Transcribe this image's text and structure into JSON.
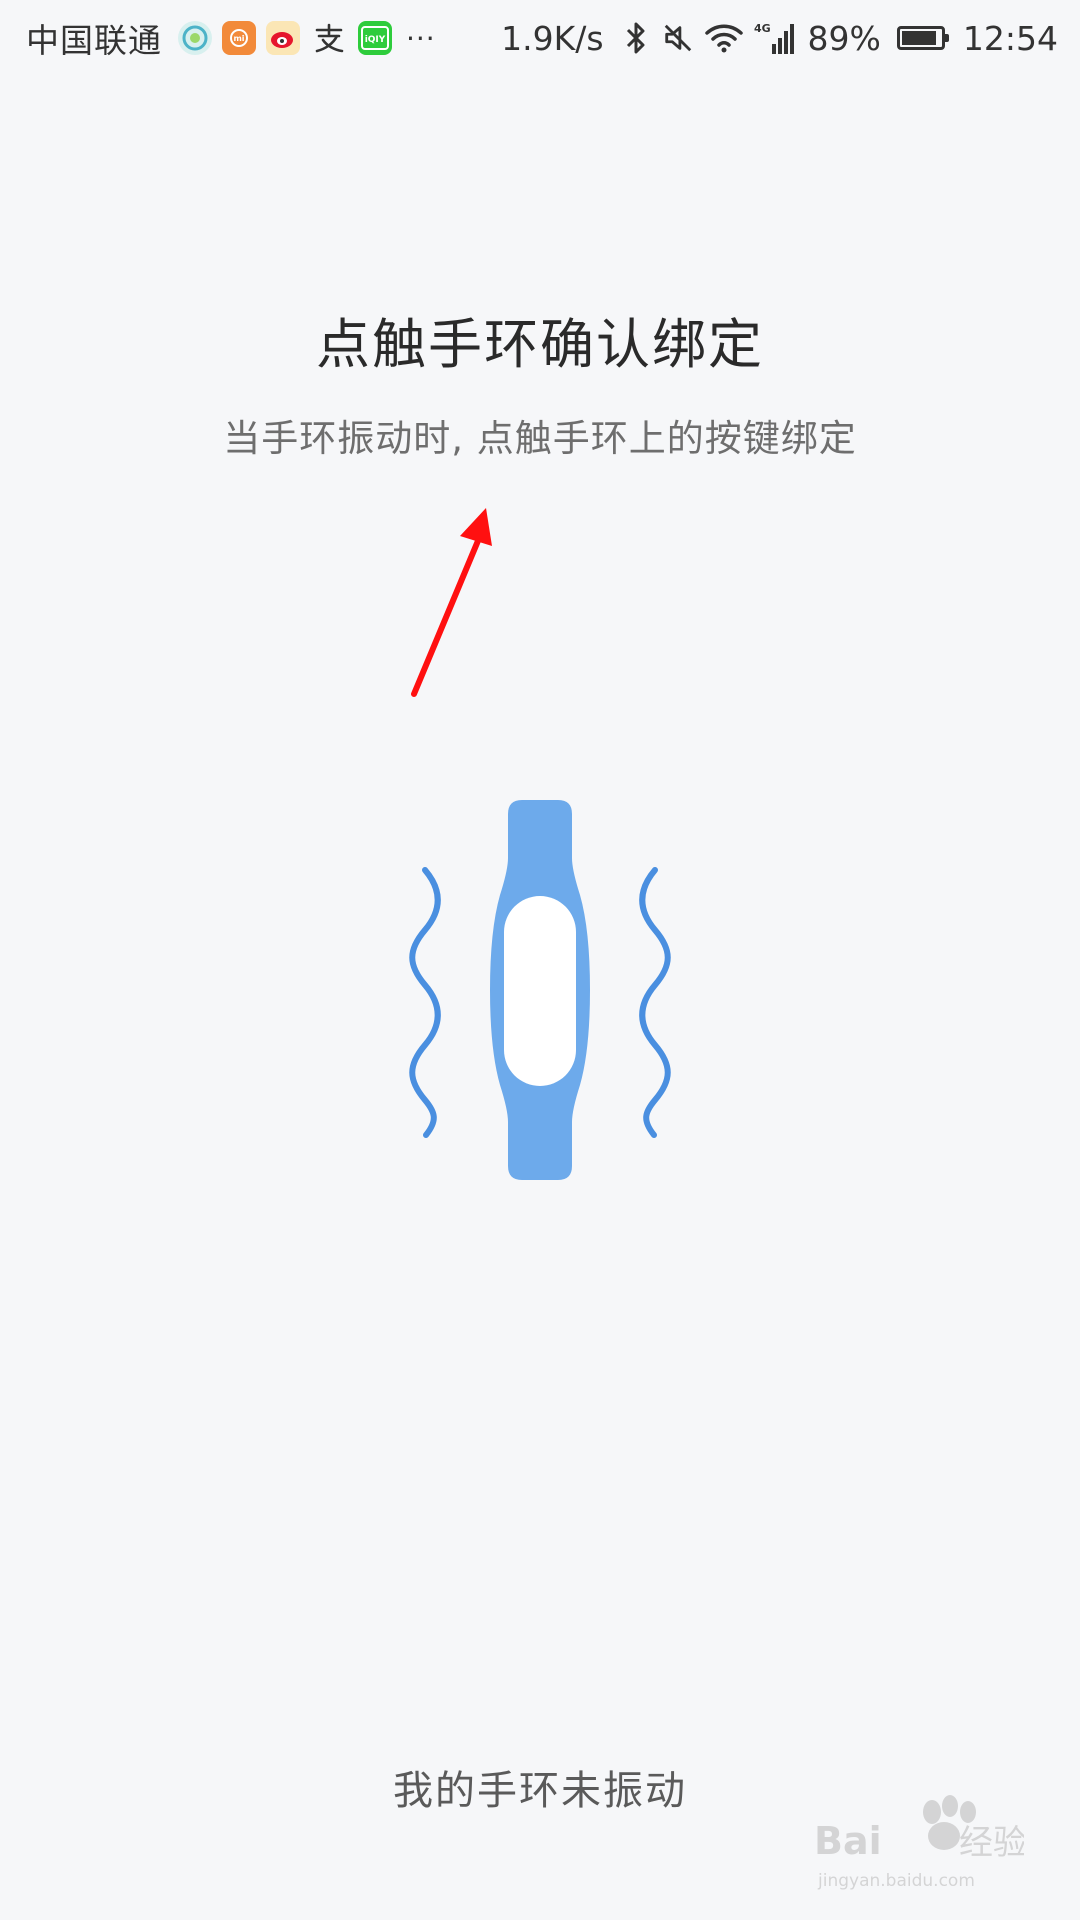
{
  "status_bar": {
    "carrier": "中国联通",
    "more": "···",
    "net_speed": "1.9K/s",
    "network_type": "4G",
    "battery_percent": "89%",
    "battery_level": 0.89,
    "time": "12:54",
    "app_icons": [
      "baofeng-icon",
      "xiaomi-mi-icon",
      "weibo-icon",
      "alipay-icon",
      "iqiyi-icon"
    ]
  },
  "main": {
    "title": "点触手环确认绑定",
    "subtitle": "当手环振动时, 点触手环上的按键绑定",
    "illustration": "vibrating-band-icon",
    "annotation": "red-arrow"
  },
  "footer": {
    "link_label": "我的手环未振动"
  },
  "watermark": {
    "brand": "Baidu经验",
    "url": "jingyan.baidu.com"
  },
  "colors": {
    "background": "#f6f7f9",
    "band_blue": "#6daaeb",
    "wave_blue": "#4a8fe0",
    "arrow_red": "#ff1010"
  }
}
